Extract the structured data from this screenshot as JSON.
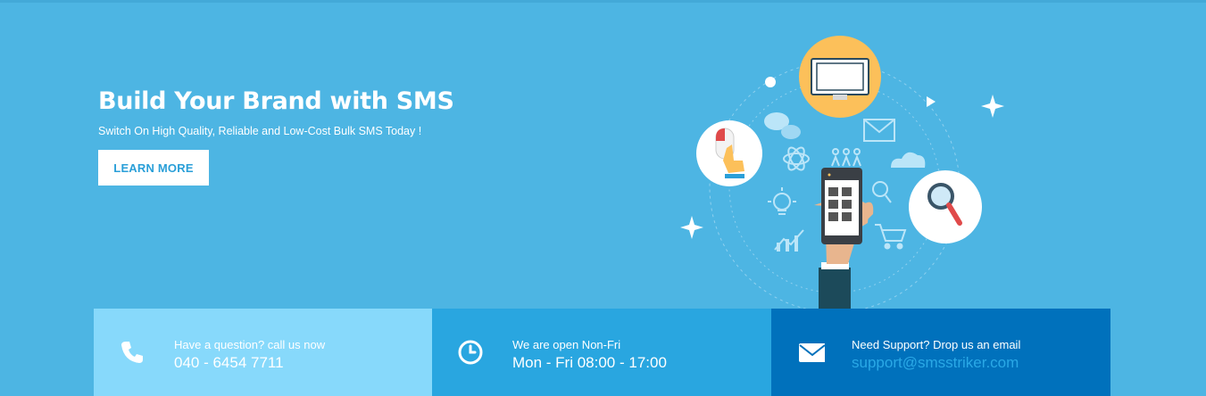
{
  "hero": {
    "title": "Build Your Brand with SMS",
    "subtitle": "Switch On High Quality, Reliable and Low-Cost Bulk SMS Today !",
    "cta_label": "LEARN MORE"
  },
  "contact_bar": {
    "items": [
      {
        "icon": "phone-icon",
        "title": "Have a question? call us now",
        "value": "040 - 6454 7711",
        "bg": "#87d9fb"
      },
      {
        "icon": "clock-icon",
        "title": "We are open Non-Fri",
        "value": "Mon - Fri 08:00 - 17:00",
        "bg": "#29a6e0"
      },
      {
        "icon": "envelope-icon",
        "title": "Need Support? Drop us an email",
        "value": "support@smsstriker.com",
        "bg": "#0071bc"
      }
    ]
  },
  "colors": {
    "background": "#4db5e3",
    "cta_text": "#2a9fd8",
    "email_link": "#2aa8e6"
  }
}
